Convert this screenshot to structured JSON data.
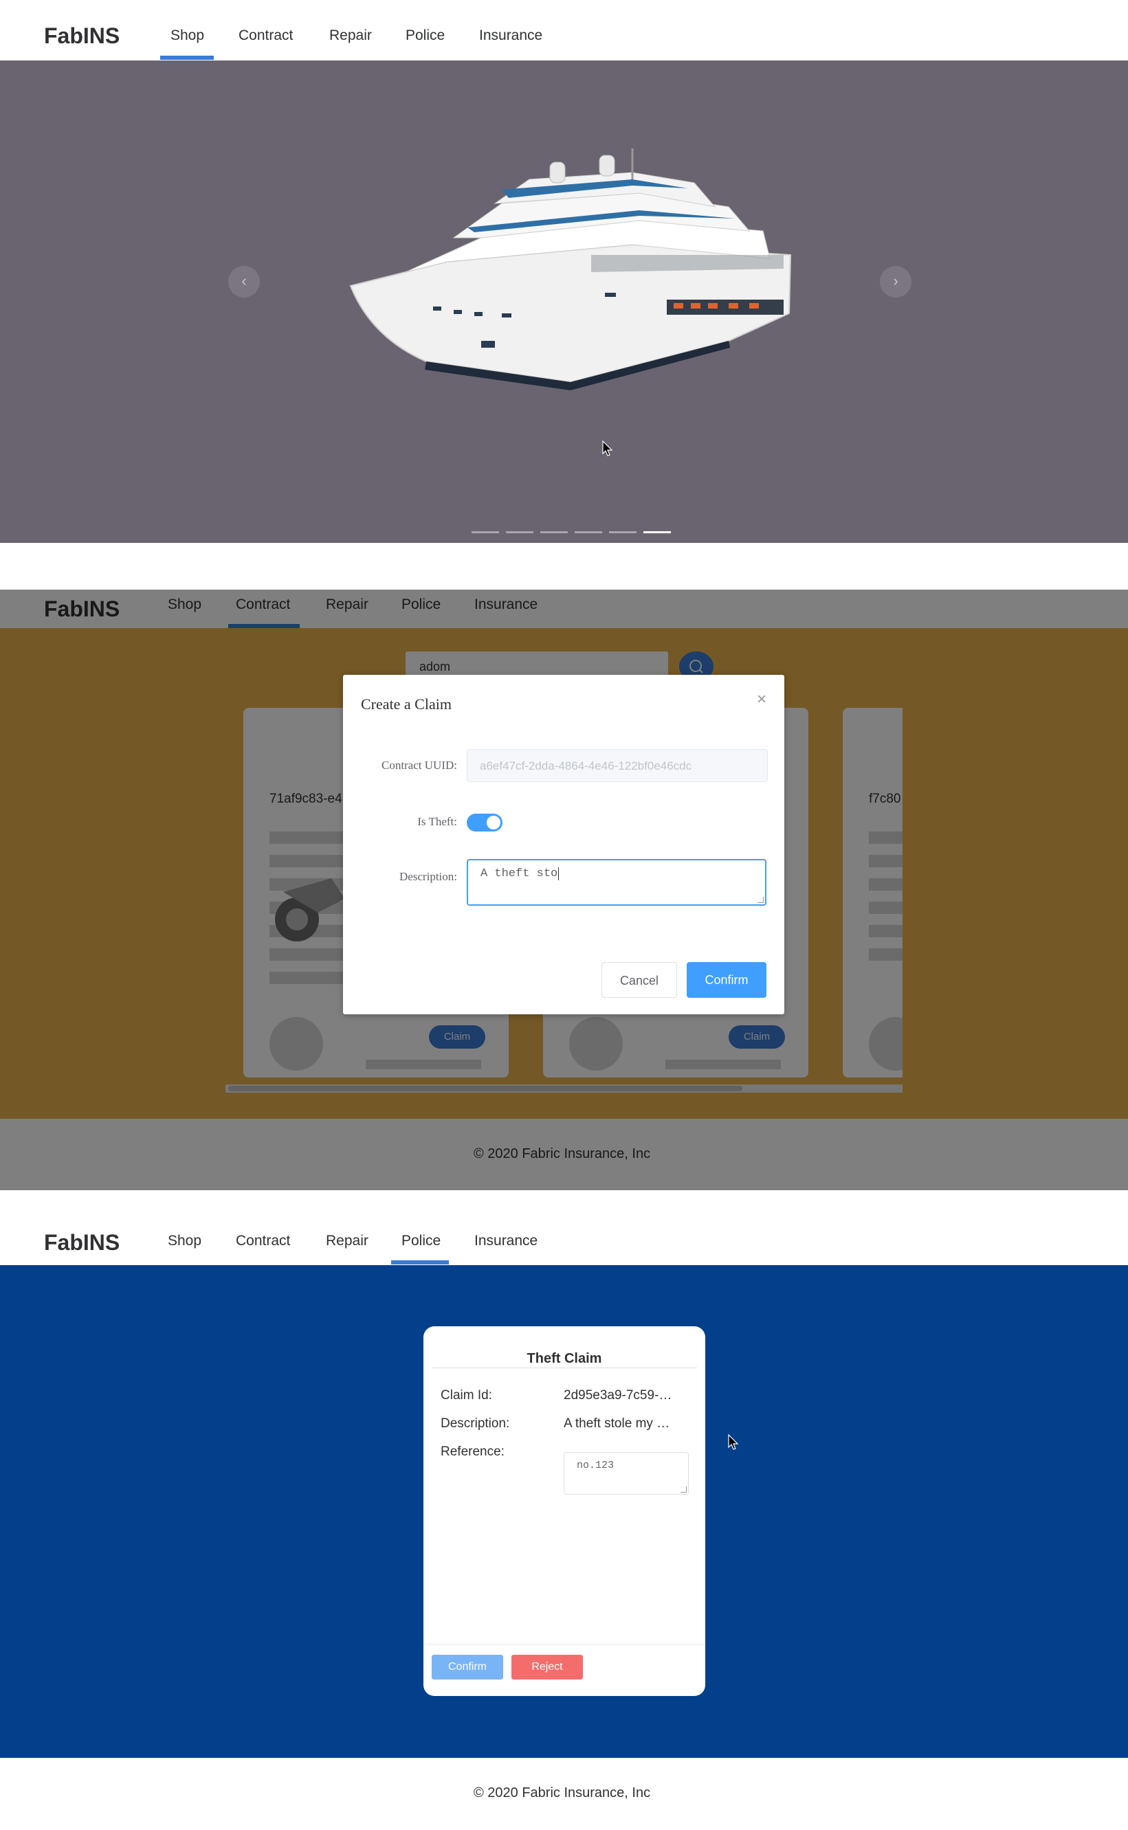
{
  "app": {
    "brand": "FabINS"
  },
  "nav": {
    "items": [
      "Shop",
      "Contract",
      "Repair",
      "Police",
      "Insurance"
    ]
  },
  "screens": [
    {
      "active_tab": "Shop"
    },
    {
      "active_tab": "Contract"
    },
    {
      "active_tab": "Police"
    }
  ],
  "carousel": {
    "prev_icon": "chevron-left-icon",
    "next_icon": "chevron-right-icon",
    "prev_glyph": "‹",
    "next_glyph": "›",
    "slide_count": 6,
    "active_slide": 6,
    "image": "cruise-ship"
  },
  "contract": {
    "search_value": "adom",
    "cards": [
      {
        "uuid_partial": "71af9c83-e4",
        "claim_label": "Claim"
      },
      {
        "uuid_partial": "",
        "claim_label": "Claim"
      },
      {
        "uuid_partial": "f7c80",
        "claim_label": ""
      }
    ],
    "background_color": "#e8b04a"
  },
  "claim_dialog": {
    "title": "Create a Claim",
    "close_glyph": "×",
    "contract_uuid_label": "Contract UUID:",
    "contract_uuid_value": "a6ef47cf-2dda-4864-4e46-122bf0e46cdc",
    "is_theft_label": "Is Theft:",
    "is_theft": true,
    "description_label": "Description:",
    "description_value": "A theft sto",
    "cancel_label": "Cancel",
    "confirm_label": "Confirm"
  },
  "footer": {
    "copyright": "© 2020 Fabric Insurance, Inc"
  },
  "police": {
    "card_title": "Theft Claim",
    "claim_id_label": "Claim Id:",
    "claim_id_value": "2d95e3a9-7c59-…",
    "description_label": "Description:",
    "description_value": "A theft stole my …",
    "reference_label": "Reference:",
    "reference_value": "no.123",
    "confirm_label": "Confirm",
    "reject_label": "Reject",
    "background_color": "#033f8a"
  }
}
